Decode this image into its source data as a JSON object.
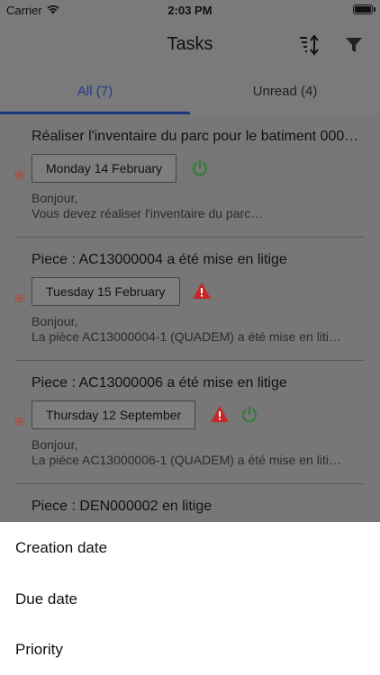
{
  "status": {
    "carrier": "Carrier",
    "time": "2:03 PM"
  },
  "nav": {
    "title": "Tasks",
    "sort_icon": "sort-icon",
    "filter_icon": "filter-icon"
  },
  "tabs": [
    {
      "label": "All (7)",
      "selected": true
    },
    {
      "label": "Unread (4)",
      "selected": false
    }
  ],
  "tasks": [
    {
      "title": "Réaliser l'inventaire du parc pour le batiment 000…",
      "date": "Monday 14 February",
      "body_line1": "Bonjour,",
      "body_line2": "Vous devez réaliser l'inventaire du parc…",
      "icons": [
        "power-icon"
      ]
    },
    {
      "title": "Piece : AC13000004 a été mise en litige",
      "date": "Tuesday 15 February",
      "body_line1": "Bonjour,",
      "body_line2": "La pièce AC13000004-1 (QUADEM) a été mise en liti…",
      "icons": [
        "warning-icon"
      ]
    },
    {
      "title": "Piece : AC13000006 a été mise en litige",
      "date": "Thursday 12 September",
      "body_line1": "Bonjour,",
      "body_line2": "La pièce AC13000006-1 (QUADEM) a été mise en liti…",
      "icons": [
        "warning-icon",
        "power-icon"
      ]
    },
    {
      "title": "Piece : DEN000002 en litige"
    }
  ],
  "sort_sheet": {
    "options": [
      "Creation date",
      "Due date",
      "Priority"
    ]
  },
  "colors": {
    "accent_blue": "#173a7a",
    "power_green": "#2e7d32",
    "warning_red": "#c62828",
    "unread_red": "#c0392b"
  }
}
